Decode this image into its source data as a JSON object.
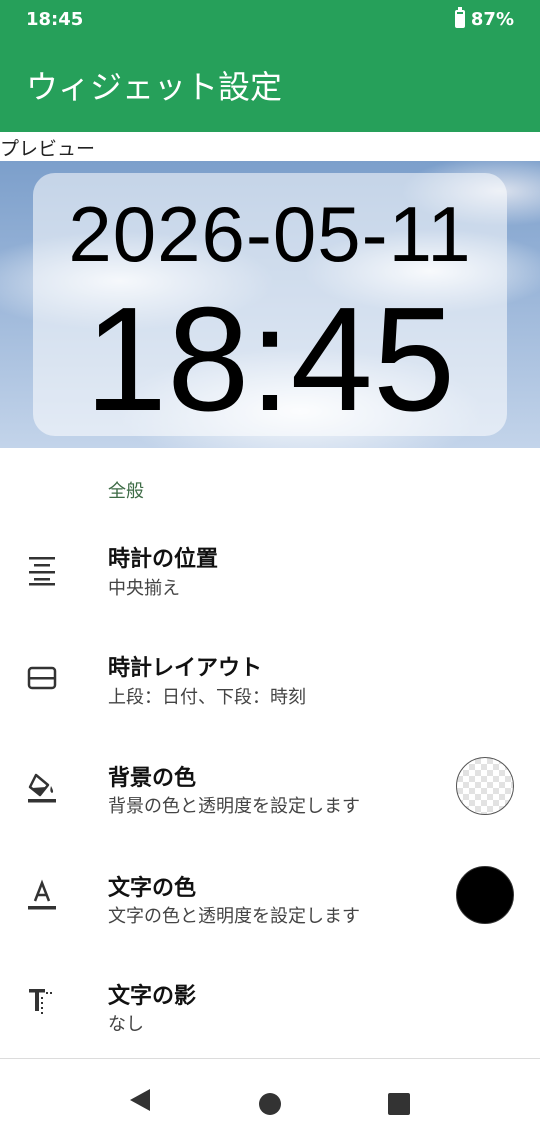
{
  "status_bar": {
    "time": "18:45",
    "battery_percent": "87%",
    "battery_level": 0.87
  },
  "app_bar": {
    "title": "ウィジェット設定"
  },
  "preview": {
    "label": "プレビュー",
    "date": "2026-05-11",
    "time": "18:45"
  },
  "section": {
    "header": "全般"
  },
  "settings": [
    {
      "title": "時計の位置",
      "subtitle": "中央揃え",
      "icon": "align-center-icon"
    },
    {
      "title": "時計レイアウト",
      "subtitle": "上段：日付、下段：時刻",
      "icon": "layout-icon"
    },
    {
      "title": "背景の色",
      "subtitle": "背景の色と透明度を設定します",
      "icon": "paint-bucket-icon",
      "swatch": "transparent"
    },
    {
      "title": "文字の色",
      "subtitle": "文字の色と透明度を設定します",
      "icon": "text-color-icon",
      "swatch": "#000000"
    },
    {
      "title": "文字の影",
      "subtitle": "なし",
      "icon": "text-shadow-icon"
    }
  ],
  "colors": {
    "accent": "#26a05a",
    "section_header": "#3d6b45"
  },
  "nav": {
    "back_icon": "back-icon",
    "home_icon": "home-icon",
    "recents_icon": "recents-icon"
  }
}
